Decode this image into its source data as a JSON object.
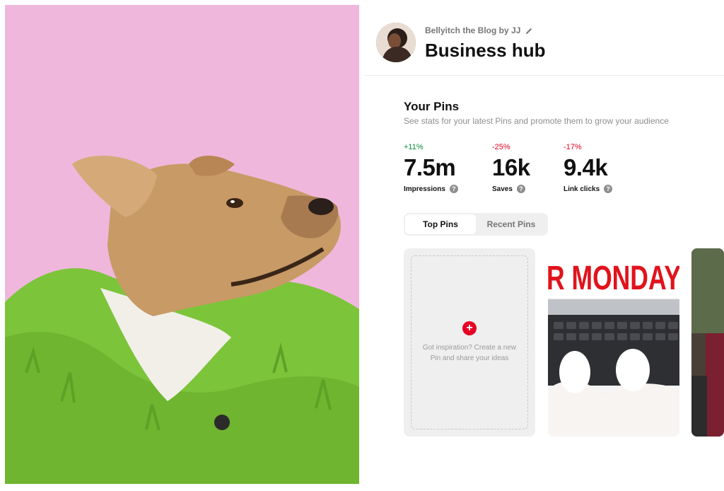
{
  "account": {
    "name": "Bellyitch the Blog by JJ",
    "title": "Business hub"
  },
  "pins_section": {
    "title": "Your Pins",
    "subtitle": "See stats for your latest Pins and promote them to grow your audience"
  },
  "stats": [
    {
      "change": "+11%",
      "direction": "up",
      "value": "7.5m",
      "label": "Impressions"
    },
    {
      "change": "-25%",
      "direction": "down",
      "value": "16k",
      "label": "Saves"
    },
    {
      "change": "-17%",
      "direction": "down",
      "value": "9.4k",
      "label": "Link clicks"
    }
  ],
  "tabs": [
    {
      "label": "Top Pins",
      "active": true
    },
    {
      "label": "Recent Pins",
      "active": false
    }
  ],
  "create_card": {
    "text": "Got inspiration? Create a new Pin and share your ideas"
  },
  "pins": [
    {
      "overlay_text": "R MONDAY"
    }
  ],
  "colors": {
    "accent_red": "#e60023",
    "positive_green": "#0a8a3a",
    "photo_background": "#f1b8dc",
    "coat_green": "#7cc43a"
  },
  "icons": [
    "pencil-icon",
    "help-icon",
    "plus-icon"
  ]
}
